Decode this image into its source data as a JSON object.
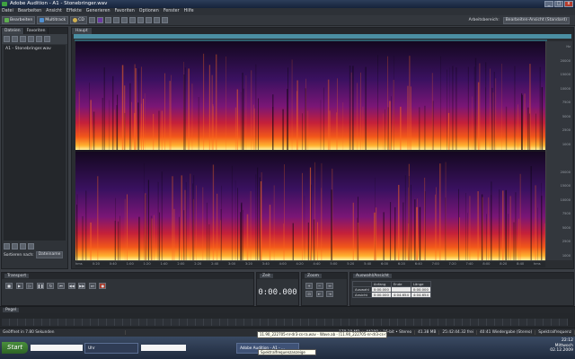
{
  "window": {
    "title": "Adobe Audition - A1 - Stonebringer.wav",
    "btn_min": "_",
    "btn_max": "□",
    "btn_close": "x"
  },
  "menu": [
    "Datei",
    "Bearbeiten",
    "Ansicht",
    "Effekte",
    "Generieren",
    "Favoriten",
    "Optionen",
    "Fenster",
    "Hilfe"
  ],
  "toolbar": {
    "edit": "Bearbeiten",
    "multitrack": "Multitrack",
    "cd": "CD",
    "workspace_label": "Arbeitsbereich:",
    "workspace_value": "Bearbeiten-Ansicht (Standard)"
  },
  "left_panel": {
    "tabs": [
      "Dateien",
      "Favoriten"
    ],
    "files": [
      "A1 - Stonebringer.wav"
    ],
    "sort_label": "Sortieren nach:",
    "sort_value": "Dateiname"
  },
  "editor": {
    "tab": "Haupt"
  },
  "freq_labels": [
    "Hz",
    "20000",
    "15000",
    "10000",
    "7500",
    "5000",
    "2500",
    "1000",
    "",
    "20000",
    "15000",
    "10000",
    "7500",
    "5000",
    "2500",
    "1000"
  ],
  "time_labels": [
    "hms",
    "0:20",
    "0:40",
    "1:00",
    "1:20",
    "1:40",
    "2:00",
    "2:20",
    "2:40",
    "3:00",
    "3:20",
    "3:40",
    "4:00",
    "4:20",
    "4:40",
    "5:00",
    "5:20",
    "5:40",
    "6:00",
    "6:20",
    "6:40",
    "7:00",
    "7:20",
    "7:40",
    "8:00",
    "8:20",
    "8:40",
    "hms"
  ],
  "transport": {
    "title": "Transport"
  },
  "time": {
    "title": "Zeit",
    "value": "0:00.000"
  },
  "zoom": {
    "title": "Zoom"
  },
  "selection": {
    "title": "Auswahl/Ansicht",
    "col_start": "Anfang",
    "col_end": "Ende",
    "col_length": "Länge",
    "row_sel": "Auswahl",
    "row_view": "Ansicht",
    "sel_start": "0:00.000",
    "sel_end": "",
    "sel_len": "0:00.000",
    "view_start": "0:00.000",
    "view_end": "4:04.654",
    "view_len": "4:04.654"
  },
  "levels": {
    "title": "Pegel"
  },
  "status": {
    "left": "Geöffnet in 7.80 Sekunden",
    "rate": "44100 • 16-bit • Stereo",
    "size": "41.38 MB",
    "free": "179.18 MB",
    "free_time": "40:41 Wiedergabe (Stereo)",
    "duration": "25:42:44.32 frei",
    "mode": "Spektralfrequenz"
  },
  "taskbar": {
    "start": "Start",
    "entries": [
      "Adobe Audition - A1 - ..."
    ],
    "folder": "Uhr",
    "tooltip_top": "11.90_222705-nr-dr3-cs-ra.wav - Wave.ab - [11.90_222705-nr-dr3-cs-ra.wav]",
    "tooltip_bottom": "Spektralfrequenzanzeige",
    "clock_time": "22:12",
    "clock_day": "Mittwoch",
    "clock_date": "02.12.2009"
  }
}
